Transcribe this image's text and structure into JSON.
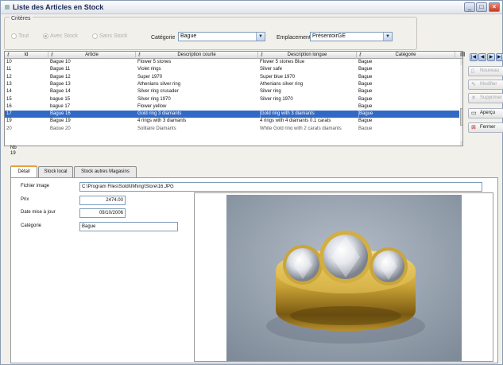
{
  "window": {
    "title": "Liste des Articles en Stock",
    "buttons": {
      "min": "_",
      "max": "□",
      "close": "×"
    }
  },
  "criteria": {
    "legend": "Critères",
    "radios": [
      {
        "label": "Tout",
        "selected": false
      },
      {
        "label": "Avec Stock",
        "selected": true
      },
      {
        "label": "Sans Stock",
        "selected": false
      }
    ],
    "categorie": {
      "label": "Catégorie",
      "value": "Bague"
    },
    "emplacement": {
      "label": "Emplacement",
      "value": "PrésentoirGE"
    }
  },
  "grid": {
    "columns": [
      "Id",
      "Article",
      "Description courte",
      "Description longue",
      "Catégorie"
    ],
    "rows": [
      {
        "id": "10",
        "article": "Bague 10",
        "desc_courte": "Flower 5 stones",
        "desc_longue": "Flower 5 stones Blue",
        "categorie": "Bague"
      },
      {
        "id": "11",
        "article": "Bague 11",
        "desc_courte": "Violet rings",
        "desc_longue": "Silver safe",
        "categorie": "Bague"
      },
      {
        "id": "12",
        "article": "Bague 12",
        "desc_courte": "Super 1970",
        "desc_longue": "Super blue 1970",
        "categorie": "Bague"
      },
      {
        "id": "13",
        "article": "Bague 13",
        "desc_courte": "Athenians silver ring",
        "desc_longue": "Athenians silver ring",
        "categorie": "Bague"
      },
      {
        "id": "14",
        "article": "Bague 14",
        "desc_courte": "Silver ring crusader",
        "desc_longue": "Silver ring",
        "categorie": "Bague"
      },
      {
        "id": "15",
        "article": "bague 15",
        "desc_courte": "Silver ring 1970",
        "desc_longue": "Silver ring 1970",
        "categorie": "Bague"
      },
      {
        "id": "16",
        "article": "bague 17",
        "desc_courte": "Flower yellow",
        "desc_longue": "",
        "categorie": "Bague"
      },
      {
        "id": "17",
        "article": "Bague 16",
        "desc_courte": "Gold ring 3 diamants",
        "desc_longue": "Gold ring with 3 diamants",
        "categorie": "Bague"
      },
      {
        "id": "19",
        "article": "Bague 19",
        "desc_courte": "4 rings with 3 diamants",
        "desc_longue": "4 rings with 4 diamants 0.1 carats",
        "categorie": "Bague"
      },
      {
        "id": "20",
        "article": "Bague 20",
        "desc_courte": "Solitaire Diamants",
        "desc_longue": "White Gold ring with 2 carats diamants",
        "categorie": "Bague"
      }
    ],
    "selected_row": 7,
    "footer": {
      "label": "Nb",
      "value": "19"
    }
  },
  "side_buttons": {
    "nav": [
      "|◀",
      "◀",
      "▶",
      "▶|"
    ],
    "nouveau": "Nouveau",
    "modifier": "Modifier",
    "supprimer": "Supprimer",
    "apercu": "Aperçu",
    "fermer": "Fermer"
  },
  "tabs": [
    "Détail",
    "Stock local",
    "Stock autres Magasins"
  ],
  "active_tab": 0,
  "detail": {
    "fichier_image": {
      "label": "Fichier image",
      "value": "C:\\Program Files\\Soldi\\IM\\ing\\Store\\16.JPG"
    },
    "prix": {
      "label": "Prix",
      "value": "2474.00"
    },
    "date_maj": {
      "label": "Date mise à jour",
      "value": "09/10/2006"
    },
    "categorie": {
      "label": "Catégorie",
      "value": "Bague"
    }
  },
  "colors": {
    "selection": "#316ac5",
    "gold": "#c9a236",
    "photo_bg": "#9aa6b4",
    "accent_tab": "#e8a23c"
  }
}
